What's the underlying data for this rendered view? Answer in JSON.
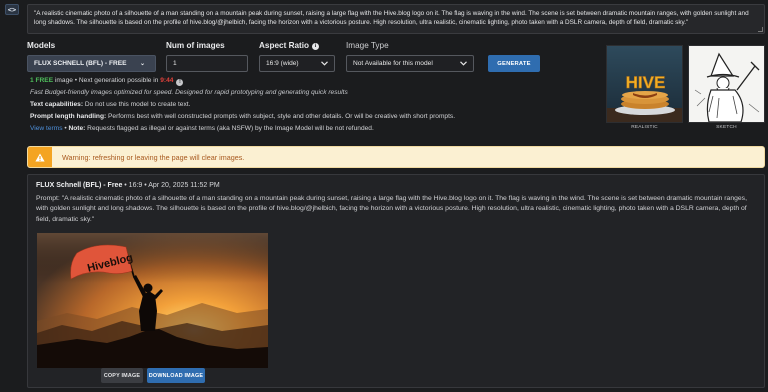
{
  "toggle": {
    "icon": "code-toggle-icon",
    "glyph": "<>"
  },
  "prompt_input": {
    "value": "\"A realistic cinematic photo of a silhouette of a man standing on a mountain peak during sunset, raising a large flag with the Hive.blog logo on it. The flag is waving in the wind. The scene is set between dramatic mountain ranges, with golden sunlight and long shadows. The silhouette is based on the profile of hive.blog/@jhelbich, facing the horizon with a victorious posture. High resolution, ultra realistic, cinematic lighting, photo taken with a DSLR camera, depth of field, dramatic sky.\""
  },
  "controls": {
    "models_label": "Models",
    "models_value": "FLUX SCHNELL (BFL) - FREE",
    "num_images_label": "Num of images",
    "num_images_value": "1",
    "aspect_label": "Aspect Ratio",
    "aspect_value": "16:9 (wide)",
    "image_type_label": "Image Type",
    "image_type_value": "Not Available for this model",
    "generate_label": "GENERATE"
  },
  "info": {
    "free_count": "1",
    "free_word": "FREE",
    "image_word": " image",
    "next_gen_text": "Next generation possible in ",
    "next_gen_time": "9:44",
    "tagline": "Fast Budget-friendly images optimized for speed. Designed for rapid prototyping and generating quick results",
    "text_cap_label": "Text capabilities:",
    "text_cap_value": " Do not use this model to create text.",
    "prompt_len_label": "Prompt length handling:",
    "prompt_len_value": " Performs best with well constructed prompts with subject, style and other details. Or will be creative with short prompts.",
    "view_terms": "View terms",
    "note_label": "Note:",
    "note_value": " Requests flagged as illegal or against terms (aka NSFW) by the Image Model will be not refunded.",
    "separator": " • "
  },
  "style_thumbs": [
    {
      "label": "REALISTIC",
      "logo_text": "HIVE"
    },
    {
      "label": "SKETCH"
    }
  ],
  "warning": {
    "text": "Warning: refreshing or leaving the page will clear images."
  },
  "result": {
    "model": "FLUX Schnell (BFL) - Free",
    "meta": " • 16:9 • Apr 20, 2025 11:52 PM",
    "prompt_label": "Prompt: ",
    "prompt_text": "\"A realistic cinematic photo of a silhouette of a man standing on a mountain peak during sunset, raising a large flag with the Hive.blog logo on it. The flag is waving in the wind. The scene is set between dramatic mountain ranges, with golden sunlight and long shadows. The silhouette is based on the profile of hive.blog/@jhelbich, facing the horizon with a victorious posture. High resolution, ultra realistic, cinematic lighting, photo taken with a DSLR camera, depth of field, dramatic sky.\"",
    "flag_text": "Hiveblog",
    "copy_label": "COPY IMAGE",
    "download_label": "DOWNLOAD IMAGE"
  },
  "colors": {
    "background": "#1b1c1e",
    "accent_blue": "#2f6db0",
    "free_green": "#4fbf5c",
    "timer_red": "#e2423b",
    "warning_bg": "#fbf0d2",
    "warning_icon_bg": "#f4a422",
    "warning_text": "#a8591f"
  }
}
